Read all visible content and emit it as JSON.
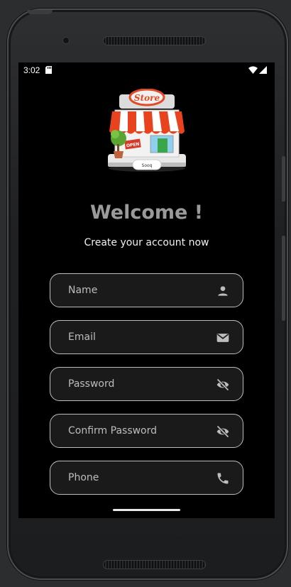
{
  "status_bar": {
    "time": "3:02",
    "sd_icon": "sd-card-icon",
    "wifi_icon": "wifi-icon",
    "signal_icon": "cell-signal-icon"
  },
  "logo": {
    "sign_text": "Store",
    "tag_text": "Sooq",
    "open_sign": "OPEN"
  },
  "heading": "Welcome !",
  "subtitle": "Create your account now",
  "fields": {
    "name": {
      "placeholder": "Name",
      "value": "",
      "icon": "person-icon"
    },
    "email": {
      "placeholder": "Email",
      "value": "",
      "icon": "mail-icon"
    },
    "password": {
      "placeholder": "Password",
      "value": "",
      "icon": "visibility-off-icon"
    },
    "confirm_password": {
      "placeholder": "Confirm Password",
      "value": "",
      "icon": "visibility-off-icon"
    },
    "phone": {
      "placeholder": "Phone",
      "value": "",
      "icon": "phone-icon"
    }
  },
  "colors": {
    "screen_bg": "#000000",
    "heading": "#9a9a9a",
    "field_border": "#bdbdbd",
    "icon": "#bdbdbd"
  }
}
